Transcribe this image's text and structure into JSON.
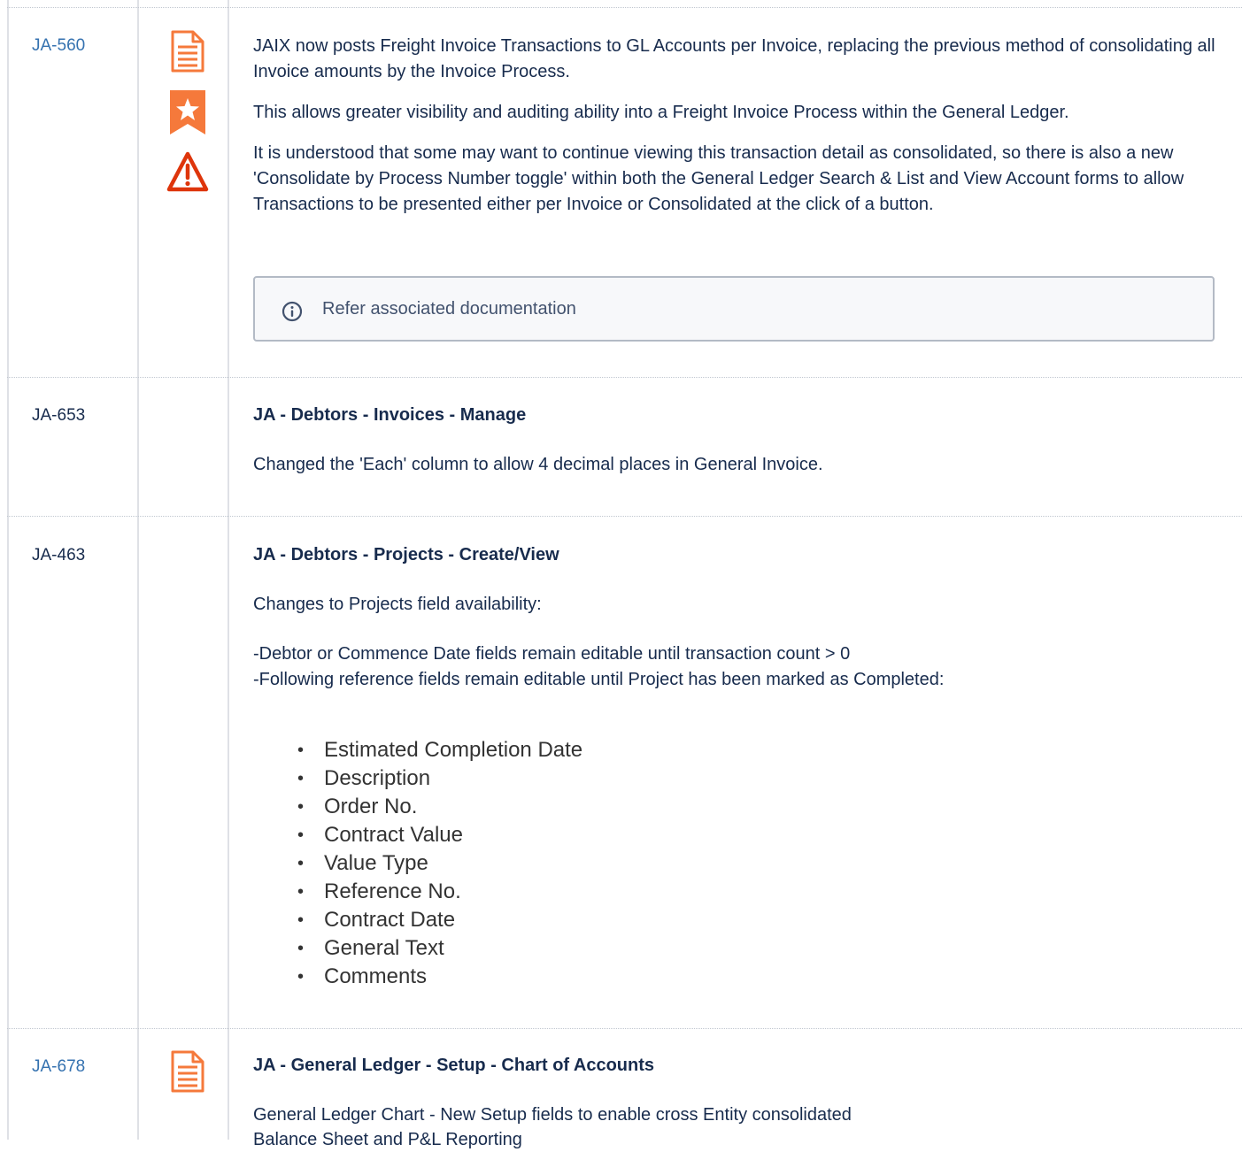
{
  "rows": [
    {
      "id": "JA-560",
      "paragraphs": [
        "JAIX now posts Freight Invoice Transactions to GL Accounts per Invoice, replacing the previous method of consolidating all Invoice amounts by the Invoice Process.",
        "This allows greater visibility and auditing ability into a Freight Invoice Process within the General Ledger.",
        "It is understood that some may want to continue viewing this transaction detail as consolidated, so there is also a new 'Consolidate by Process Number toggle' within both the General Ledger Search & List and View Account forms to allow Transactions to be presented either per Invoice or Consolidated at the click of a button."
      ],
      "info_panel": "Refer associated documentation",
      "icons": [
        "document-icon",
        "star-bookmark-icon",
        "warning-icon"
      ]
    },
    {
      "id": "JA-653",
      "heading": "JA - Debtors - Invoices - Manage",
      "body": "Changed the 'Each' column to allow 4 decimal places in General Invoice."
    },
    {
      "id": "JA-463",
      "heading": "JA - Debtors - Projects - Create/View",
      "intro": "Changes to Projects field availability:",
      "line1": "-Debtor or Commence Date fields remain editable until transaction count > 0",
      "line2": "-Following reference fields remain editable until Project has been marked as Completed:",
      "fields": [
        "Estimated Completion Date",
        "Description",
        "Order No.",
        "Contract Value",
        "Value Type",
        "Reference No.",
        "Contract Date",
        "General Text",
        "Comments"
      ]
    },
    {
      "id": "JA-678",
      "heading": "JA - General Ledger - Setup - Chart of Accounts",
      "body_line1": "General Ledger Chart - New Setup fields to enable cross Entity consolidated",
      "body_line2": "Balance Sheet and P&L Reporting",
      "icons": [
        "document-icon"
      ]
    }
  ],
  "colors": {
    "link": "#3572b0",
    "icon_orange": "#f5793b",
    "warning_red": "#de350b",
    "border": "#dfe1e6"
  }
}
